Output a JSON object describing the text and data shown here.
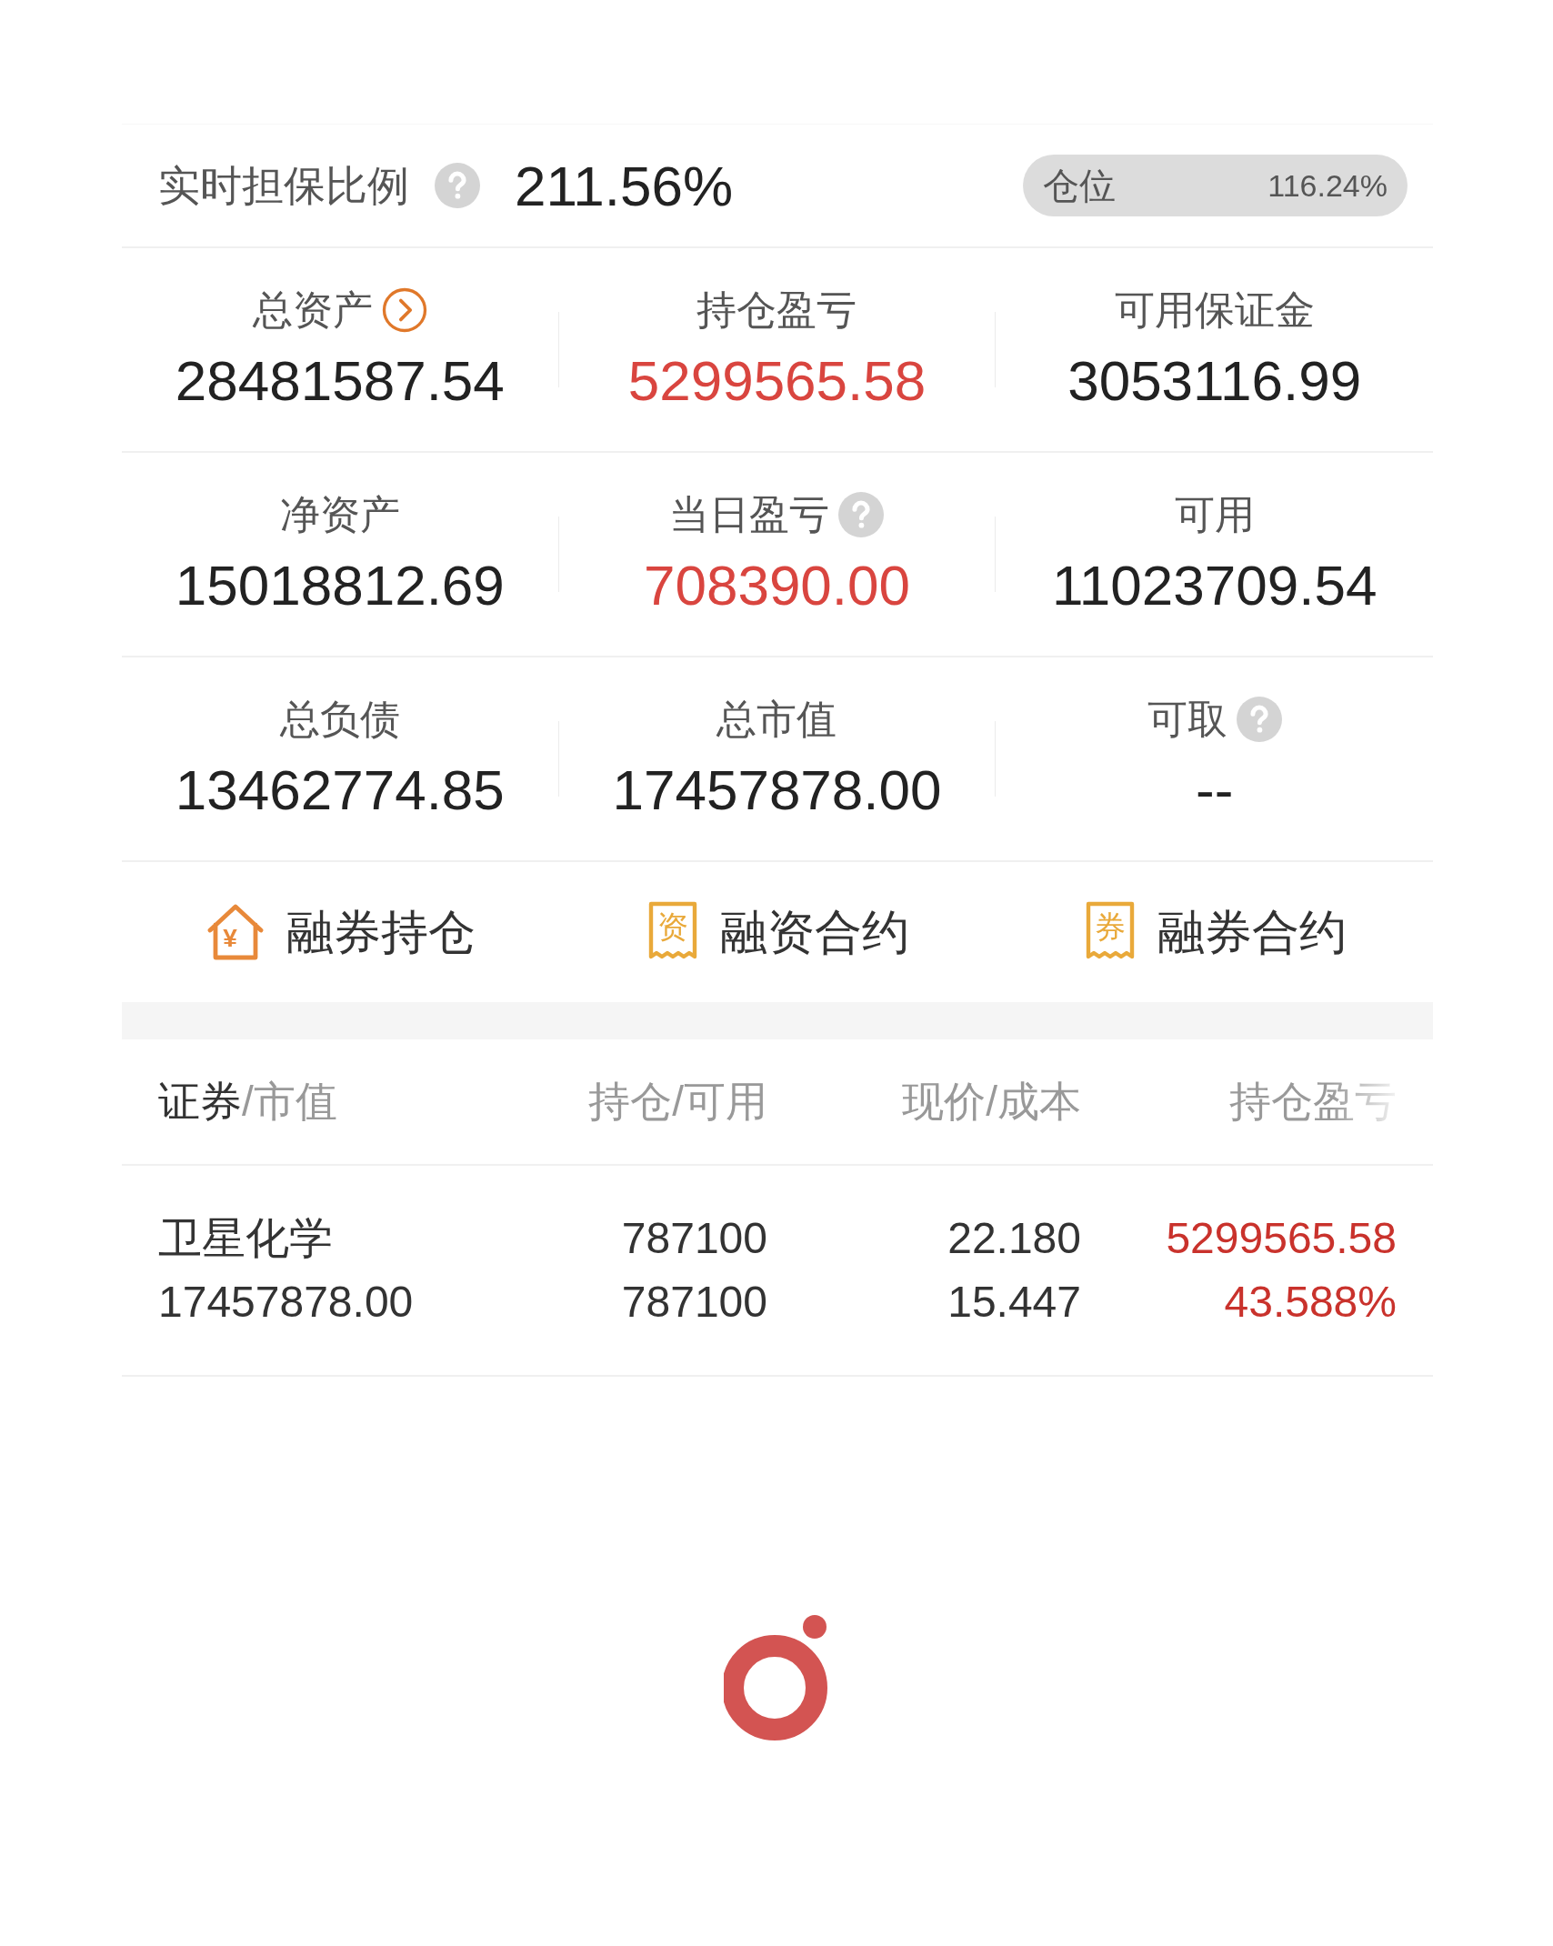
{
  "collateral": {
    "label": "实时担保比例",
    "value": "211.56%",
    "position": {
      "label": "仓位",
      "value": "116.24%"
    }
  },
  "metrics": [
    {
      "label": "总资产",
      "kind": "chevron",
      "value": "28481587.54",
      "positive": false
    },
    {
      "label": "持仓盈亏",
      "kind": "plain",
      "value": "5299565.58",
      "positive": true
    },
    {
      "label": "可用保证金",
      "kind": "plain",
      "value": "3053116.99",
      "positive": false
    },
    {
      "label": "净资产",
      "kind": "plain",
      "value": "15018812.69",
      "positive": false
    },
    {
      "label": "当日盈亏",
      "kind": "help",
      "value": "708390.00",
      "positive": true
    },
    {
      "label": "可用",
      "kind": "plain",
      "value": "11023709.54",
      "positive": false
    },
    {
      "label": "总负债",
      "kind": "plain",
      "value": "13462774.85",
      "positive": false
    },
    {
      "label": "总市值",
      "kind": "plain",
      "value": "17457878.00",
      "positive": false
    },
    {
      "label": "可取",
      "kind": "help",
      "value": "--",
      "positive": false
    }
  ],
  "shortcuts": [
    {
      "kind": "house",
      "glyph": "¥",
      "label": "融券持仓"
    },
    {
      "kind": "receipt",
      "glyph": "资",
      "label": "融资合约"
    },
    {
      "kind": "receipt",
      "glyph": "券",
      "label": "融券合约"
    }
  ],
  "table": {
    "columns": [
      {
        "primary": "证券",
        "secondary": "/市值",
        "faded": false
      },
      {
        "primary": "持仓/可用",
        "faded": false
      },
      {
        "primary": "现价/成本",
        "faded": false
      },
      {
        "primary": "持仓盈亏",
        "faded": true
      }
    ],
    "rows": [
      {
        "name": "卫星化学",
        "market_value": "17457878.00",
        "holding": "787100",
        "available": "787100",
        "price": "22.180",
        "cost": "15.447",
        "pnl": "5299565.58",
        "pnl_ratio": "43.588%",
        "positive": true
      }
    ]
  }
}
